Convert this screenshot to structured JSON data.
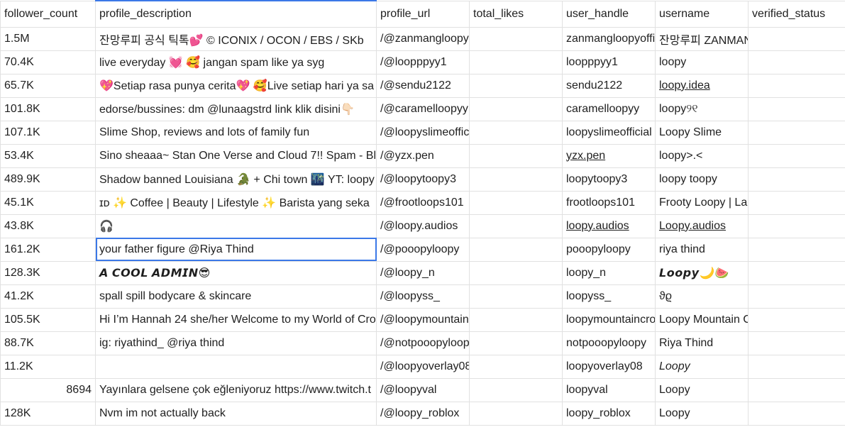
{
  "headers": [
    "follower_count",
    "profile_description",
    "profile_url",
    "total_likes",
    "user_handle",
    "username",
    "verified_status"
  ],
  "rows": [
    {
      "follower_count": "1.5M",
      "profile_description": "잔망루피 공식 틱톡💕 © ICONIX / OCON / EBS / SKb",
      "profile_url": "/@zanmangloopyofficial",
      "total_likes": "",
      "user_handle": "zanmangloopyoffi",
      "username": "잔망루피 ZANMANG LOOPY",
      "verified_status": ""
    },
    {
      "follower_count": "70.4K",
      "profile_description": "live everyday 💓 🥰 jangan spam like ya syg",
      "profile_url": "/@loopppyy1",
      "total_likes": "",
      "user_handle": "loopppyy1",
      "username": "loopy",
      "verified_status": ""
    },
    {
      "follower_count": "65.7K",
      "profile_description": "💖Setiap rasa punya cerita💖 🥰Live setiap hari ya sa",
      "profile_url": "/@sendu2122",
      "total_likes": "",
      "user_handle": "sendu2122",
      "username": "loopy.idea",
      "verified_status": ""
    },
    {
      "follower_count": "101.8K",
      "profile_description": "edorse/bussines: dm @lunaagstrd link klik disini👇🏻",
      "profile_url": "/@caramelloopyy",
      "total_likes": "",
      "user_handle": "caramelloopyy",
      "username": "loopy୨୧",
      "verified_status": ""
    },
    {
      "follower_count": "107.1K",
      "profile_description": "Slime Shop, reviews and lots of family fun",
      "profile_url": "/@loopyslimeofficial",
      "total_likes": "",
      "user_handle": "loopyslimeofficial",
      "username": "Loopy Slime",
      "verified_status": ""
    },
    {
      "follower_count": "53.4K",
      "profile_description": "Sino sheaaa~ Stan One Verse and Cloud 7!! Spam - Bl",
      "profile_url": "/@yzx.pen",
      "total_likes": "",
      "user_handle": "yzx.pen",
      "username": "loopy>.<",
      "verified_status": ""
    },
    {
      "follower_count": "489.9K",
      "profile_description": "Shadow banned Louisiana 🐊 + Chi town 🌃 YT: loopy",
      "profile_url": "/@loopytoopy3",
      "total_likes": "",
      "user_handle": "loopytoopy3",
      "username": "loopy toopy",
      "verified_status": ""
    },
    {
      "follower_count": "45.1K",
      "profile_description": "ɪᴅ ✨ Coffee | Beauty | Lifestyle ✨ Barista yang seka",
      "profile_url": "/@frootloops101",
      "total_likes": "",
      "user_handle": "frootloops101",
      "username": "Frooty Loopy | Lagi hobi lari",
      "verified_status": ""
    },
    {
      "follower_count": "43.8K",
      "profile_description": "🎧",
      "profile_url": "/@loopy.audios",
      "total_likes": "",
      "user_handle": "loopy.audios",
      "username": "Loopy.audios",
      "verified_status": ""
    },
    {
      "follower_count": "161.2K",
      "profile_description": "your father figure @Riya Thind",
      "profile_url": "/@pooopyloopy",
      "total_likes": "",
      "user_handle": "pooopyloopy",
      "username": "riya thind",
      "verified_status": ""
    },
    {
      "follower_count": "128.3K",
      "profile_description": "𝘼 𝘾𝙊𝙊𝙇 𝘼𝘿𝙈𝙄𝙉😎",
      "profile_url": "/@loopy_n",
      "total_likes": "",
      "user_handle": "loopy_n",
      "username": "𝙇𝙤𝙤𝙥𝙮🌙🍉",
      "verified_status": ""
    },
    {
      "follower_count": "41.2K",
      "profile_description": "spall spill bodycare & skincare",
      "profile_url": "/@loopyss_",
      "total_likes": "",
      "user_handle": "loopyss_",
      "username": "ϑϱ",
      "verified_status": ""
    },
    {
      "follower_count": "105.5K",
      "profile_description": "Hi I’m Hannah 24 she/her Welcome to my World of Cro",
      "profile_url": "/@loopymountaincrochet",
      "total_likes": "",
      "user_handle": "loopymountaincro",
      "username": "Loopy Mountain Crochet",
      "verified_status": ""
    },
    {
      "follower_count": "88.7K",
      "profile_description": "ig: riyathind_ @riya thind",
      "profile_url": "/@notpooopyloopy",
      "total_likes": "",
      "user_handle": "notpooopyloopy",
      "username": "Riya Thind",
      "verified_status": ""
    },
    {
      "follower_count": "11.2K",
      "profile_description": "",
      "profile_url": "/@loopyoverlay08",
      "total_likes": "",
      "user_handle": "loopyoverlay08",
      "username": "Loopy",
      "verified_status": ""
    },
    {
      "follower_count": "8694",
      "profile_description": "Yayınlara gelsene çok eğleniyoruz https://www.twitch.t",
      "profile_url": "/@loopyval",
      "total_likes": "",
      "user_handle": "loopyval",
      "username": "Loopy",
      "verified_status": ""
    },
    {
      "follower_count": "128K",
      "profile_description": "Nvm im not actually back",
      "profile_url": "/@loopy_roblox",
      "total_likes": "",
      "user_handle": "loopy_roblox",
      "username": "Loopy",
      "verified_status": ""
    }
  ],
  "colors": {
    "selection": "#3b78e7",
    "link": "#1155cc",
    "gridline": "#e1e1e1"
  }
}
